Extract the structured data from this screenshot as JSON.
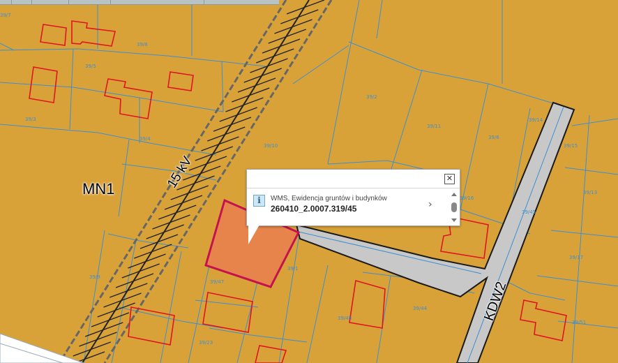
{
  "map": {
    "zone_label": "MN1",
    "road_label": "KDW2",
    "powerline_label": "15 kV",
    "parcel_numbers": [
      "39/8",
      "39/5",
      "39/3",
      "39/10",
      "39/2",
      "39/11",
      "39/4",
      "39/6",
      "39/15",
      "39/14",
      "39/13",
      "39/16",
      "39/45",
      "39/1",
      "39/9",
      "39/47",
      "39/48",
      "39/44",
      "39/51",
      "39/17",
      "39/7",
      "39/23"
    ],
    "colors": {
      "background": "#d9a239",
      "parcel_line": "#3d8fd0",
      "building_outline": "#e0141e",
      "selected_fill": "#e6844c",
      "selected_outline": "#c4124e",
      "road_fill": "#c8c8c8",
      "powerline": "#222222"
    }
  },
  "popup": {
    "close_symbol": "✕",
    "info_symbol": "i",
    "layer_name": "WMS, Ewidencja gruntów i budynków",
    "feature_id": "260410_2.0007.319/45",
    "arrow_symbol": "›"
  }
}
